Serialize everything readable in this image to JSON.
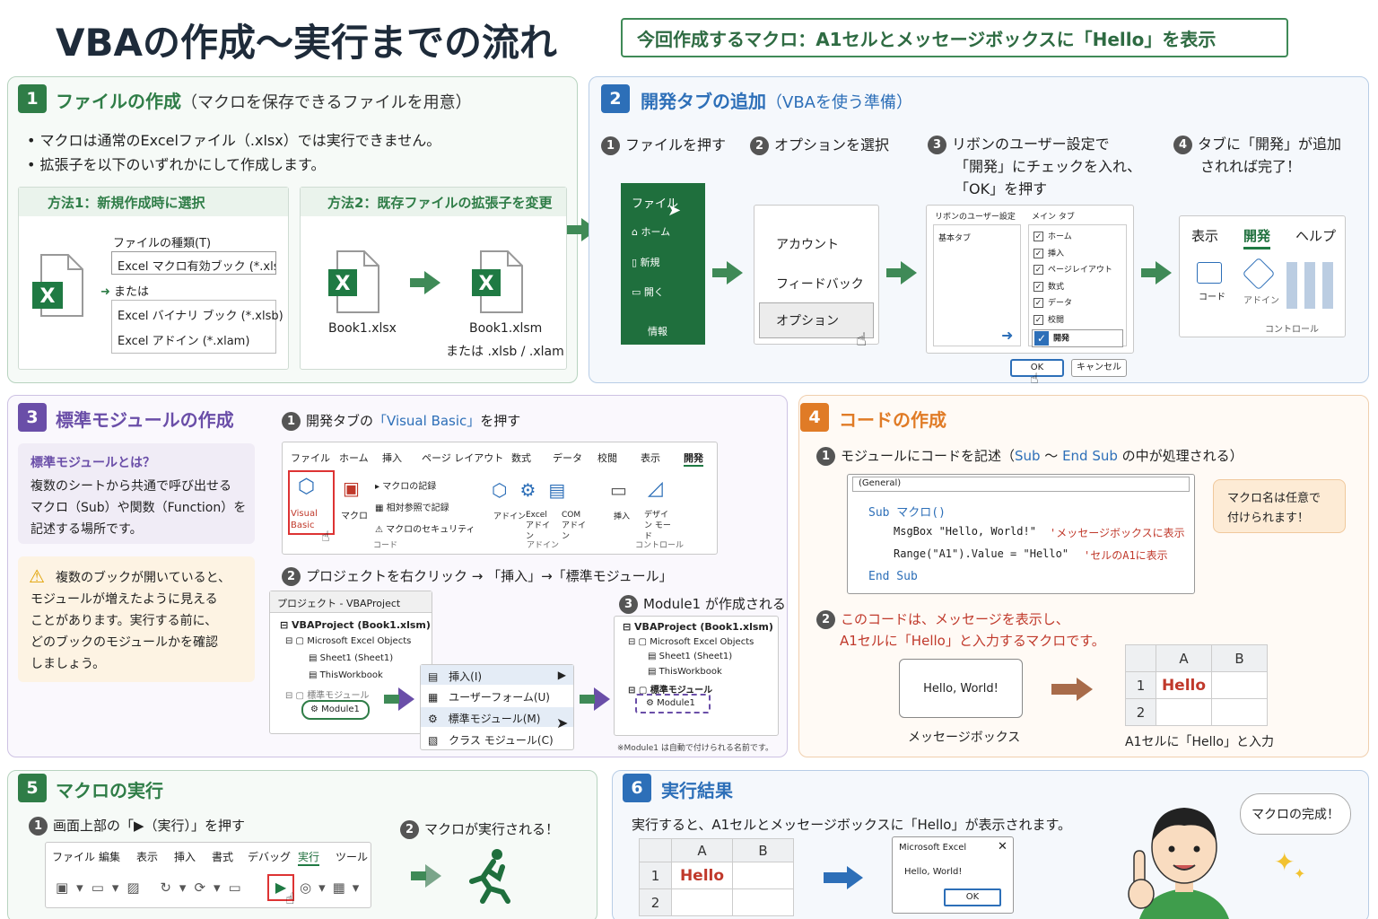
{
  "header": {
    "title": "VBAの作成〜実行までの流れ",
    "macro_note": "今回作成するマクロ：A1セルとメッセージボックスに「Hello」を表示"
  },
  "s1": {
    "num": "1",
    "title": "ファイルの作成",
    "title_sub": "（マクロを保存できるファイルを用意）",
    "bullets": [
      "マクロは通常のExcelファイル（.xlsx）では実行できません。",
      "拡張子を以下のいずれかにして作成します。"
    ],
    "m1": {
      "title": "方法1：新規作成時に選択",
      "type_label": "ファイルの種類(T)",
      "opt1": "Excel マクロ有効ブック (*.xlsm)",
      "or": "または",
      "opt2": "Excel バイナリ ブック (*.xlsb)",
      "opt3": "Excel アドイン (*.xlam)"
    },
    "m2": {
      "title": "方法2：既存ファイルの拡張子を変更",
      "from": "Book1.xlsx",
      "to": "Book1.xlsm",
      "to_sub": "または .xlsb / .xlam"
    }
  },
  "s2": {
    "num": "2",
    "title": "開発タブの追加",
    "title_sub": "（VBAを使う準備）",
    "steps": [
      {
        "n": "1",
        "text": "ファイルを押す"
      },
      {
        "n": "2",
        "text": "オプションを選択"
      },
      {
        "n": "3",
        "text": "リボンのユーザー設定で",
        "l2": "「開発」にチェックを入れ、",
        "l3": "「OK」を押す"
      },
      {
        "n": "4",
        "text": "タブに「開発」が追加",
        "l2": "されれば完了！"
      }
    ],
    "file_menu": [
      "ファイル",
      "ホーム",
      "新規",
      "開く",
      "情報"
    ],
    "options": [
      "アカウント",
      "フィードバック",
      "オプション"
    ],
    "ribbon_dlg": {
      "left": "リボンのユーザー設定",
      "main": "メイン タブ",
      "leftitem": "基本タブ",
      "items": [
        "ホーム",
        "挿入",
        "ページレイアウト",
        "数式",
        "データ",
        "校閲",
        "開発"
      ],
      "ok": "OK",
      "cancel": "キャンセル"
    },
    "tabs": [
      "表示",
      "開発",
      "ヘルプ"
    ],
    "code": "コード",
    "addin": "アドイン",
    "ctrl": "コントロール"
  },
  "s3": {
    "num": "3",
    "title": "標準モジュールの作成",
    "what_title": "標準モジュールとは？",
    "what": [
      "複数のシートから共通で呼び出せる",
      "マクロ（Sub）や関数（Function）を",
      "記述する場所です。"
    ],
    "warn": [
      "複数のブックが開いていると、",
      "モジュールが増えたように見える",
      "ことがあります。実行する前に、",
      "どのブックのモジュールかを確認",
      "しましょう。"
    ],
    "step1": {
      "n": "1",
      "pre": "開発タブの",
      "hl": "「Visual Basic」",
      "post": "を押す"
    },
    "ribbon_tabs": [
      "ファイル",
      "ホーム",
      "挿入",
      "ページ レイアウト",
      "数式",
      "データ",
      "校閲",
      "表示",
      "開発"
    ],
    "vb": "Visual Basic",
    "macro": "マクロ",
    "rec": "マクロの記録",
    "rel": "相対参照で記録",
    "sec": "マクロのセキュリティ",
    "code_grp": "コード",
    "addins": [
      "アドイン",
      "Excel アドイン",
      "COM アドイン"
    ],
    "addin_grp": "アドイン",
    "ins": "挿入",
    "design": "デザイン モード",
    "ctrl_grp": "コントロール",
    "step2": {
      "n": "2",
      "text": "プロジェクトを右クリック → 「挿入」→「標準モジュール」"
    },
    "proj_title": "プロジェクト - VBAProject",
    "proj": [
      "VBAProject (Book1.xlsm)",
      "Microsoft Excel Objects",
      "Sheet1 (Sheet1)",
      "ThisWorkbook",
      "標準モジュール",
      "Module1"
    ],
    "menu": [
      "挿入(I)",
      "ユーザーフォーム(U)",
      "標準モジュール(M)",
      "クラス モジュール(C)"
    ],
    "step3": {
      "n": "3",
      "text": "Module1 が作成される"
    },
    "note": "※Module1 は自動で付けられる名前です。"
  },
  "s4": {
    "num": "4",
    "title": "コードの作成",
    "step1": {
      "n": "1",
      "pre": "モジュールにコードを記述（",
      "k1": "Sub",
      "mid": " 〜 ",
      "k2": "End Sub",
      "post": " の中が処理される）"
    },
    "general": "(General)",
    "code": [
      "Sub マクロ()",
      "MsgBox \"Hello, World!\"",
      "'メッセージボックスに表示",
      "Range(\"A1\").Value = \"Hello\"",
      "'セルのA1に表示",
      "End Sub"
    ],
    "bubble": [
      "マクロ名は任意で",
      "付けられます！"
    ],
    "step2": {
      "n": "2",
      "l1": "このコードは、メッセージを表示し、",
      "l2": "A1セルに「Hello」と入力するマクロです。"
    },
    "msg": "Hello, World!",
    "msg_label": "メッセージボックス",
    "cols": [
      "A",
      "B"
    ],
    "rows": [
      "1",
      "2"
    ],
    "cell": "Hello",
    "cell_label": "A1セルに「Hello」と入力"
  },
  "s5": {
    "num": "5",
    "title": "マクロの実行",
    "step1": {
      "n": "1",
      "text": "画面上部の「▶（実行）」を押す"
    },
    "menu": [
      "ファイル",
      "編集",
      "表示",
      "挿入",
      "書式",
      "デバッグ",
      "実行",
      "ツール"
    ],
    "step2": {
      "n": "2",
      "text": "マクロが実行される！"
    }
  },
  "s6": {
    "num": "6",
    "title": "実行結果",
    "desc": "実行すると、A1セルとメッセージボックスに「Hello」が表示されます。",
    "cols": [
      "A",
      "B"
    ],
    "rows": [
      "1",
      "2"
    ],
    "cell": "Hello",
    "dlg_title": "Microsoft Excel",
    "dlg_msg": "Hello, World!",
    "ok": "OK",
    "bubble": "マクロの完成！"
  }
}
